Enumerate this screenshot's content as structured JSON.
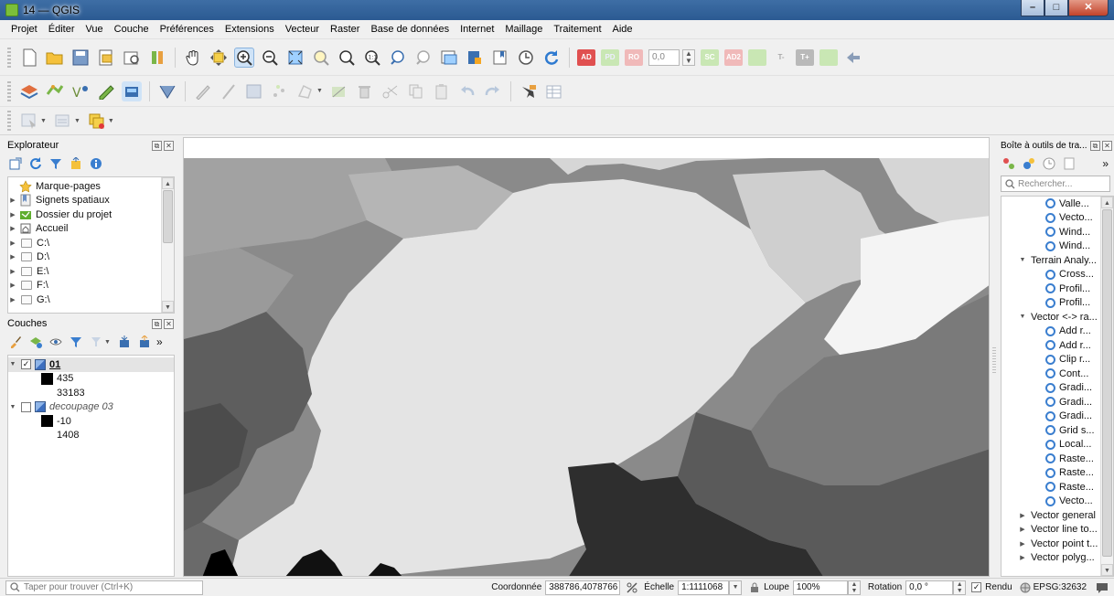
{
  "window": {
    "title": "14 — QGIS",
    "minimize_icon": "minimize-icon",
    "maximize_icon": "maximize-icon",
    "close_icon": "close-icon"
  },
  "menu": [
    "Projet",
    "Éditer",
    "Vue",
    "Couche",
    "Préférences",
    "Extensions",
    "Vecteur",
    "Raster",
    "Base de données",
    "Internet",
    "Maillage",
    "Traitement",
    "Aide"
  ],
  "toolbar_labels": {
    "ad": "AD",
    "pd": "PD",
    "ro": "RO",
    "rotation_value": "0,0",
    "sc": "SC",
    "ad2": "AD2",
    "t_minus": "T-",
    "t_plus": "T+"
  },
  "browser": {
    "title": "Explorateur",
    "items": [
      {
        "label": "Marque-pages",
        "icon": "star-icon",
        "expandable": false
      },
      {
        "label": "Signets spatiaux",
        "icon": "bookmark-icon",
        "expandable": true
      },
      {
        "label": "Dossier du projet",
        "icon": "project-folder-icon",
        "expandable": true
      },
      {
        "label": "Accueil",
        "icon": "home-icon",
        "expandable": true
      },
      {
        "label": "C:\\",
        "icon": "drive-icon",
        "expandable": true
      },
      {
        "label": "D:\\",
        "icon": "drive-icon",
        "expandable": true
      },
      {
        "label": "E:\\",
        "icon": "drive-icon",
        "expandable": true
      },
      {
        "label": "F:\\",
        "icon": "drive-icon",
        "expandable": true
      },
      {
        "label": "G:\\",
        "icon": "drive-icon",
        "expandable": true
      }
    ]
  },
  "layers": {
    "title": "Couches",
    "items": [
      {
        "name": "01",
        "checked": true,
        "min": "435",
        "max": "33183"
      },
      {
        "name": "decoupage 03",
        "checked": false,
        "min": "-10",
        "max": "1408"
      }
    ]
  },
  "toolbox": {
    "title": "Boîte à outils de tra...",
    "search_placeholder": "Rechercher...",
    "rows": [
      {
        "label": "Valle...",
        "type": "algo"
      },
      {
        "label": "Vecto...",
        "type": "algo"
      },
      {
        "label": "Wind...",
        "type": "algo"
      },
      {
        "label": "Wind...",
        "type": "algo"
      },
      {
        "label": "Terrain Analy...",
        "type": "group-open"
      },
      {
        "label": "Cross...",
        "type": "algo"
      },
      {
        "label": "Profil...",
        "type": "algo"
      },
      {
        "label": "Profil...",
        "type": "algo"
      },
      {
        "label": "Vector <-> ra...",
        "type": "group-open"
      },
      {
        "label": "Add r...",
        "type": "algo"
      },
      {
        "label": "Add r...",
        "type": "algo"
      },
      {
        "label": "Clip r...",
        "type": "algo"
      },
      {
        "label": "Cont...",
        "type": "algo"
      },
      {
        "label": "Gradi...",
        "type": "algo"
      },
      {
        "label": "Gradi...",
        "type": "algo"
      },
      {
        "label": "Gradi...",
        "type": "algo"
      },
      {
        "label": "Grid s...",
        "type": "algo"
      },
      {
        "label": "Local...",
        "type": "algo"
      },
      {
        "label": "Raste...",
        "type": "algo"
      },
      {
        "label": "Raste...",
        "type": "algo"
      },
      {
        "label": "Raste...",
        "type": "algo"
      },
      {
        "label": "Vecto...",
        "type": "algo"
      },
      {
        "label": "Vector general",
        "type": "group-closed"
      },
      {
        "label": "Vector line to...",
        "type": "group-closed"
      },
      {
        "label": "Vector point t...",
        "type": "group-closed"
      },
      {
        "label": "Vector polyg...",
        "type": "group-closed"
      }
    ]
  },
  "status": {
    "locator_placeholder": "Taper pour trouver (Ctrl+K)",
    "coord_label": "Coordonnée",
    "coord_value": "388786,4078766",
    "scale_label": "Échelle",
    "scale_value": "1:1111068",
    "magnifier_label": "Loupe",
    "magnifier_value": "100%",
    "rotation_label": "Rotation",
    "rotation_value": "0,0 °",
    "render_label": "Rendu",
    "render_checked": true,
    "crs": "EPSG:32632"
  },
  "colors": {
    "accent": "#3d6fbf",
    "tag_red": "#e05050",
    "tag_disabled": "#f0b9b9",
    "tag_green_disabled": "#c9e7b4",
    "tag_grey": "#b9b9b9"
  }
}
